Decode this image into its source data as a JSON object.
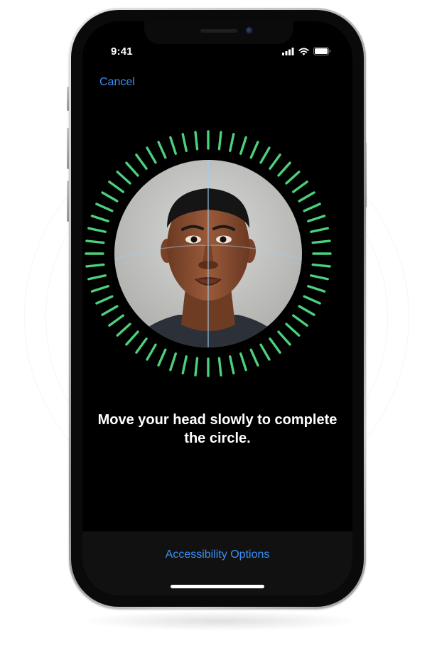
{
  "status_bar": {
    "time": "9:41",
    "icons": [
      "cellular-signal-icon",
      "wifi-icon",
      "battery-icon"
    ]
  },
  "nav": {
    "cancel_label": "Cancel"
  },
  "scan": {
    "instruction": "Move your head slowly to complete the circle.",
    "tick_color": "#4cd07d",
    "progress": 1.0
  },
  "footer": {
    "accessibility_label": "Accessibility Options"
  },
  "colors": {
    "accent": "#3b8ff5",
    "screen_bg": "#000000",
    "footer_bg": "#111111"
  }
}
